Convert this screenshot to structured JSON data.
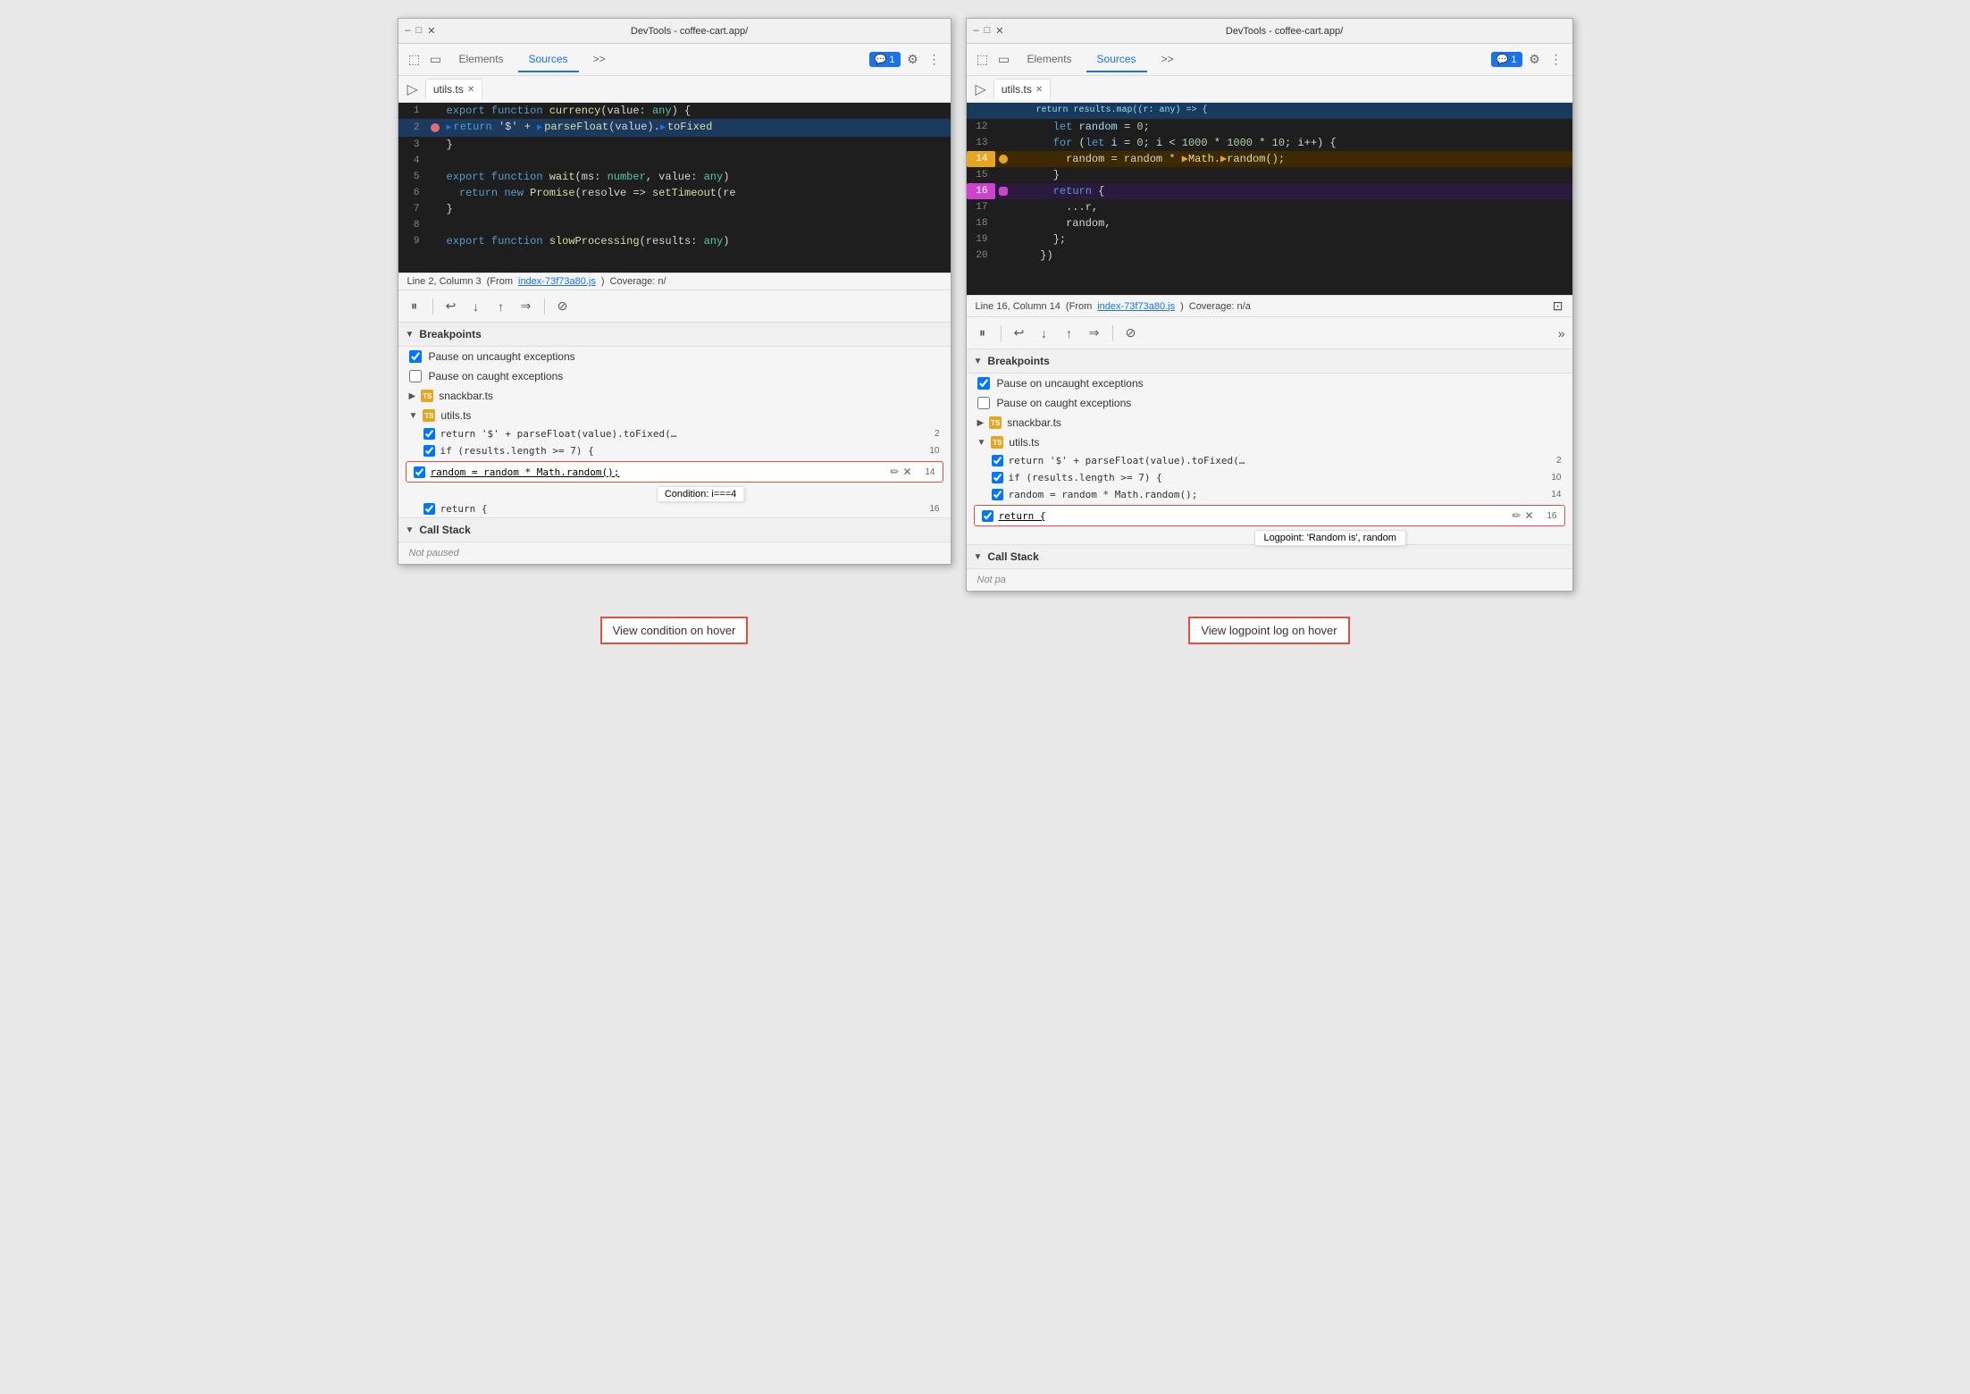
{
  "window1": {
    "title": "DevTools - coffee-cart.app/",
    "nav": {
      "tabs": [
        "Elements",
        "Sources"
      ],
      "active_tab": "Sources",
      "more_label": ">>",
      "badge": "1",
      "badge_icon": "💬"
    },
    "file_tab": "utils.ts",
    "code": {
      "lines": [
        {
          "num": "1",
          "content": "export function currency(value: any) {",
          "type": "normal"
        },
        {
          "num": "2",
          "content": "  ▶return '$' + ▶parseFloat(value).▶toFixed",
          "type": "active",
          "bp": true
        },
        {
          "num": "3",
          "content": "}",
          "type": "normal"
        },
        {
          "num": "4",
          "content": "",
          "type": "normal"
        },
        {
          "num": "5",
          "content": "export function wait(ms: number, value: any)",
          "type": "normal"
        },
        {
          "num": "6",
          "content": "  return new Promise(resolve => setTimeout(re",
          "type": "normal"
        },
        {
          "num": "7",
          "content": "}",
          "type": "normal"
        },
        {
          "num": "8",
          "content": "",
          "type": "normal"
        },
        {
          "num": "9",
          "content": "export function slowProcessing(results: any)",
          "type": "normal"
        }
      ]
    },
    "status_bar": {
      "line_col": "Line 2, Column 3",
      "from_text": "(From",
      "from_link": "index-73f73a80.js",
      "coverage": "Coverage: n/"
    },
    "debug_toolbar": {
      "pause": "⏸",
      "step_over": "↩",
      "step_into": "↓",
      "step_out": "↑",
      "continue": "→→",
      "deactivate": "⊘"
    },
    "breakpoints": {
      "header": "Breakpoints",
      "pause_uncaught": "Pause on uncaught exceptions",
      "pause_caught": "Pause on caught exceptions",
      "files": [
        {
          "name": "snackbar.ts",
          "expanded": false,
          "items": []
        },
        {
          "name": "utils.ts",
          "expanded": true,
          "items": [
            {
              "code": "return '$' + parseFloat(value).toFixed(…",
              "line": "2",
              "checked": true
            },
            {
              "code": "if (results.length >= 7) {",
              "line": "10",
              "checked": true
            },
            {
              "code": "random = random * Math.random();",
              "line": "14",
              "checked": true,
              "highlighted": true,
              "tooltip": "Condition: i===4"
            },
            {
              "code": "return {",
              "line": "16",
              "checked": true
            }
          ]
        }
      ]
    },
    "call_stack": {
      "header": "Call Stack",
      "status": "Not paused"
    },
    "annotation": "View condition on hover"
  },
  "window2": {
    "title": "DevTools - coffee-cart.app/",
    "nav": {
      "tabs": [
        "Elements",
        "Sources"
      ],
      "active_tab": "Sources",
      "more_label": ">>",
      "badge": "1"
    },
    "file_tab": "utils.ts",
    "code": {
      "lines": [
        {
          "num": "12",
          "content": "      let random = 0;",
          "type": "normal"
        },
        {
          "num": "13",
          "content": "      for (let i = 0; i < 1000 * 1000 * 10; i++) {",
          "type": "normal"
        },
        {
          "num": "14",
          "content": "        random = random * ▶Math.▶random();",
          "type": "orange-bp"
        },
        {
          "num": "15",
          "content": "      }",
          "type": "normal"
        },
        {
          "num": "16",
          "content": "      return {",
          "type": "pink-bp"
        },
        {
          "num": "17",
          "content": "        ...r,",
          "type": "normal"
        },
        {
          "num": "18",
          "content": "        random,",
          "type": "normal"
        },
        {
          "num": "19",
          "content": "      };",
          "type": "normal"
        },
        {
          "num": "20",
          "content": "    })",
          "type": "normal"
        }
      ]
    },
    "status_bar": {
      "line_col": "Line 16, Column 14",
      "from_text": "(From",
      "from_link": "index-73f73a80.js",
      "coverage": "Coverage: n/a"
    },
    "breakpoints": {
      "header": "Breakpoints",
      "pause_uncaught": "Pause on uncaught exceptions",
      "pause_caught": "Pause on caught exceptions",
      "files": [
        {
          "name": "snackbar.ts",
          "expanded": false,
          "items": []
        },
        {
          "name": "utils.ts",
          "expanded": true,
          "items": [
            {
              "code": "return '$' + parseFloat(value).toFixed(…",
              "line": "2",
              "checked": true
            },
            {
              "code": "if (results.length >= 7) {",
              "line": "10",
              "checked": true
            },
            {
              "code": "random = random * Math.random();",
              "line": "14",
              "checked": true
            },
            {
              "code": "return {",
              "line": "16",
              "checked": true,
              "highlighted": true,
              "tooltip": "Logpoint: 'Random is', random"
            }
          ]
        }
      ]
    },
    "call_stack": {
      "header": "Call Stack",
      "status": "Not pa"
    },
    "annotation": "View logpoint log on hover"
  },
  "icons": {
    "checkbox_checked": "✓",
    "arrow_right": "▶",
    "arrow_down": "▼",
    "close": "✕",
    "edit": "✏",
    "file_ts": "TS"
  }
}
